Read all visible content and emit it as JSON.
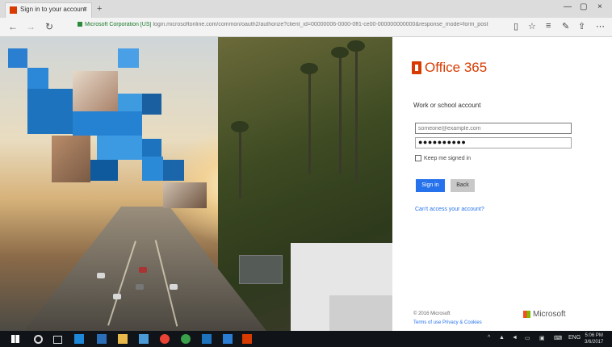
{
  "browser": {
    "tab_title": "Sign in to your account",
    "tab_close": "×",
    "new_tab": "+",
    "window_controls": [
      "—",
      "▢",
      "×"
    ],
    "url_host": "Microsoft Corporation [US]",
    "url_path": "login.microsoftonline.com/common/oauth2/authorize?client_id=00000006-0000-0ff1-ce00-000000000000&response_mode=form_post"
  },
  "signin": {
    "brand": "Office 365",
    "prompt": "Work or school account",
    "email_placeholder": "someone@example.com",
    "password_value": "●●●●●●●●●●",
    "remember_label": "Keep me signed in",
    "sign_in_label": "Sign in",
    "back_label": "Back",
    "cant_access": "Can't access your account?",
    "copyright": "© 2016 Microsoft",
    "legal_links": "Terms of use    Privacy & Cookies",
    "microsoft_label": "Microsoft"
  },
  "taskbar": {
    "tray_lang": "ENG",
    "time": "5:06 PM",
    "date": "3/6/2017"
  },
  "colors": {
    "office_orange": "#d83b01",
    "primary_blue": "#2672ec",
    "tile_blue": "#1e73be"
  }
}
